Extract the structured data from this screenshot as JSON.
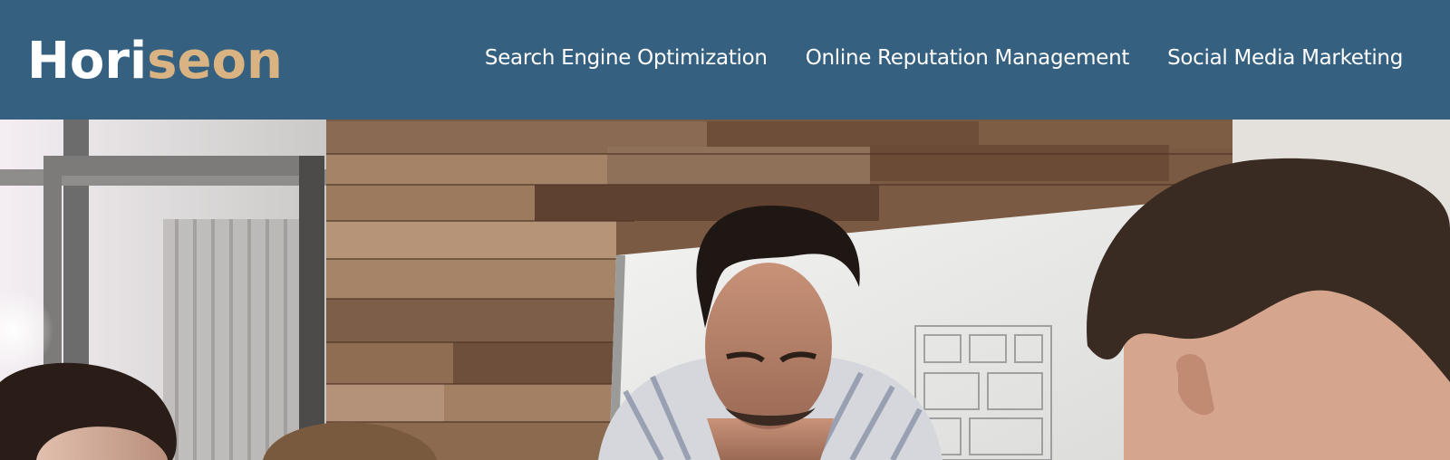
{
  "header": {
    "logo_main": "Hori",
    "logo_accent": "seon",
    "nav": [
      "Search Engine Optimization",
      "Online Reputation Management",
      "Social Media Marketing"
    ],
    "colors": {
      "background": "#35607f",
      "text": "#ffffff",
      "accent": "#d9b382"
    }
  },
  "hero": {
    "image": "office-team-meeting-photo"
  }
}
